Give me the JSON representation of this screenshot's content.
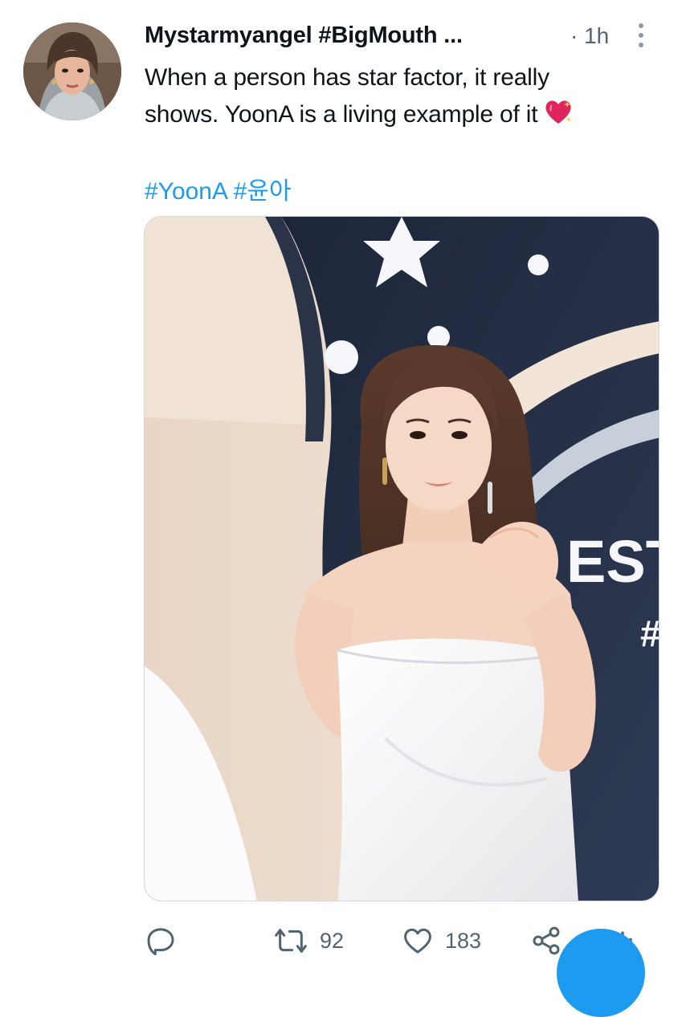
{
  "tweet": {
    "display_name": "Mystarmyangel #BigMouth ...",
    "separator": "·",
    "time": "1h",
    "text_line1": "When a person has star factor, it really",
    "text_line2": "shows. YoonA is a living example of it",
    "emoji": "sparkling-heart",
    "hashtags": [
      "#YoonA",
      "#윤아"
    ]
  },
  "media": {
    "backdrop_text": "EST",
    "backdrop_symbol": "#"
  },
  "actions": {
    "reply": {
      "icon": "reply-icon",
      "count": ""
    },
    "retweet": {
      "icon": "retweet-icon",
      "count": "92"
    },
    "like": {
      "icon": "like-icon",
      "count": "183"
    },
    "share": {
      "icon": "share-icon",
      "count": ""
    },
    "analytics": {
      "icon": "analytics-icon",
      "count": ""
    }
  },
  "colors": {
    "accent": "#1d9bf0",
    "muted": "#536471",
    "text": "#0f1419",
    "heart": "#e0245e"
  }
}
